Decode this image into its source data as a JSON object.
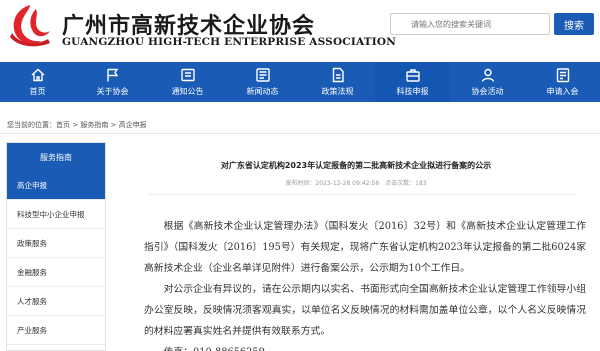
{
  "header": {
    "org_name_cn": "广州市高新技术企业协会",
    "org_name_en": "GUANGZHOU HIGH-TECH ENTERPRISE ASSOCIATION",
    "search_placeholder": "请输入您的搜索关键词",
    "search_button": "搜索"
  },
  "nav": {
    "items": [
      {
        "label": "首页",
        "icon": "home-icon"
      },
      {
        "label": "关于协会",
        "icon": "flag-icon"
      },
      {
        "label": "通知公告",
        "icon": "notice-icon"
      },
      {
        "label": "新闻动态",
        "icon": "news-icon"
      },
      {
        "label": "政策法规",
        "icon": "document-icon"
      },
      {
        "label": "科技申报",
        "icon": "briefcase-icon"
      },
      {
        "label": "协会活动",
        "icon": "user-icon"
      },
      {
        "label": "申请入会",
        "icon": "application-icon"
      }
    ],
    "active_index": 5
  },
  "breadcrumb": {
    "prefix": "您当前的位置：",
    "items": [
      "首页",
      "服务指南",
      "高企申报"
    ],
    "separator": " > "
  },
  "sidebar": {
    "title": "服务指南",
    "items": [
      "高企申报",
      "科技型中小企业申报",
      "政策服务",
      "金融服务",
      "人才服务",
      "产业服务"
    ],
    "active_index": 0
  },
  "article": {
    "title": "对广东省认定机构2023年认定报备的第二批高新技术企业拟进行备案的公示",
    "meta": "发布时间：2023-12-28 09:42:56　点击次数：183",
    "paragraphs": [
      "根据《高新技术企业认定管理办法》（国科发火〔2016〕32号）和《高新技术企业认定管理工作指引》（国科发火〔2016〕195号）有关规定，现将广东省认定机构2023年认定报备的第二批6024家高新技术企业（企业名单详见附件）进行备案公示，公示期为10个工作日。",
      "对公示企业有异议的，请在公示期内以实名、书面形式向全国高新技术企业认定管理工作领导小组办公室反映，反映情况须客观真实，以单位名义反映情况的材料需加盖单位公章，以个人名义反映情况的材料应署真实姓名并提供有效联系方式。"
    ],
    "contact": "传真：010-88656259"
  },
  "colors": {
    "brand_blue": "#1a5bb5",
    "logo_red": "#e0262b"
  }
}
